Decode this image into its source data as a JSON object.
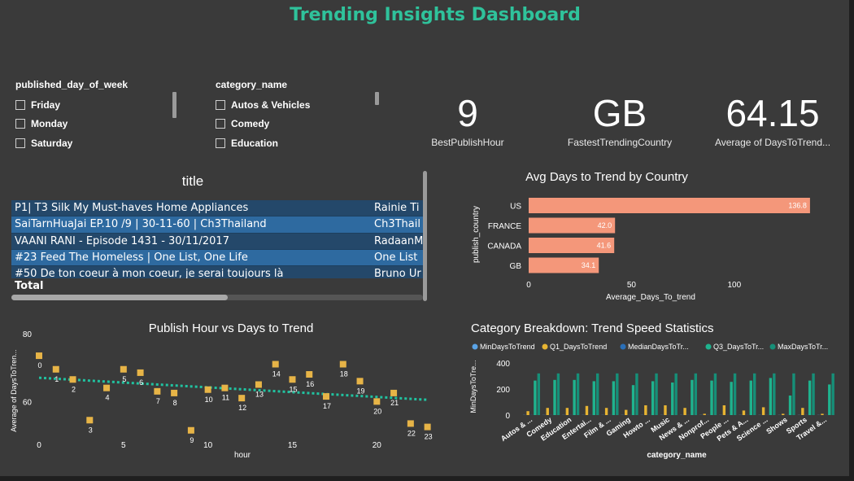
{
  "dashboard": {
    "title": "Trending Insights Dashboard"
  },
  "slicers": {
    "day": {
      "header": "published_day_of_week",
      "items": [
        "Friday",
        "Monday",
        "Saturday"
      ]
    },
    "category": {
      "header": "category_name",
      "items": [
        "Autos & Vehicles",
        "Comedy",
        "Education"
      ]
    }
  },
  "kpis": [
    {
      "value": "9",
      "label": "BestPublishHour"
    },
    {
      "value": "GB",
      "label": "FastestTrendingCountry"
    },
    {
      "value": "64.15",
      "label": "Average of DaysToTrend..."
    }
  ],
  "table": {
    "heading": "title",
    "rows": [
      {
        "title": "P1| T3 Silk My Must-haves Home Appliances",
        "channel": "Rainie Ti"
      },
      {
        "title": "SaiTarnHuaJai EP.10 /9 | 30-11-60 | Ch3Thailand",
        "channel": "Ch3Thail"
      },
      {
        "title": "VAANI RANI - Episode 1431 - 30/11/2017",
        "channel": "RadaanM"
      },
      {
        "title": "#23 Feed The Homeless | One List, One Life",
        "channel": "One List"
      },
      {
        "title": "#50 De ton coeur à mon coeur, je serai toujours là",
        "channel": "Bruno Ur"
      }
    ],
    "total_label": "Total"
  },
  "country_chart": {
    "chart_data": {
      "type": "bar",
      "orientation": "horizontal",
      "title": "Avg Days to Trend by Country",
      "xlabel": "Average_Days_To_trend",
      "ylabel": "publish_country",
      "categories": [
        "US",
        "FRANCE",
        "CANADA",
        "GB"
      ],
      "values": [
        136.8,
        42.0,
        41.6,
        34.1
      ],
      "data_labels": [
        "136.8",
        "42.0",
        "41.6",
        "34.1"
      ],
      "xlim": [
        0,
        140
      ],
      "xticks": [
        "0",
        "50",
        "100"
      ],
      "color": "#f4977a"
    }
  },
  "scatter_chart": {
    "chart_data": {
      "type": "scatter",
      "title": "Publish Hour vs Days to Trend",
      "xlabel": "hour",
      "ylabel": "Average of DaysToTren...",
      "x": [
        0,
        1,
        2,
        3,
        4,
        5,
        6,
        7,
        8,
        9,
        10,
        11,
        12,
        13,
        14,
        15,
        16,
        17,
        18,
        19,
        20,
        21,
        22,
        23
      ],
      "y": [
        73.5,
        69.5,
        66.5,
        54.5,
        64.0,
        69.5,
        68.5,
        63.0,
        62.5,
        51.5,
        63.5,
        64.0,
        61.0,
        65.0,
        71.0,
        66.5,
        68.0,
        61.5,
        71.0,
        66.0,
        60.0,
        62.5,
        53.5,
        52.5
      ],
      "point_labels": [
        "0",
        "1",
        "2",
        "3",
        "4",
        "5",
        "6",
        "7",
        "8",
        "9",
        "10",
        "11",
        "12",
        "13",
        "14",
        "15",
        "16",
        "17",
        "18",
        "19",
        "20",
        "21",
        "22",
        "23"
      ],
      "trendline": {
        "start": [
          0,
          67.0
        ],
        "end": [
          23,
          60.5
        ]
      },
      "xlim": [
        0,
        23.5
      ],
      "ylim": [
        50,
        80
      ],
      "xticks": [
        "0",
        "5",
        "10",
        "15",
        "20"
      ],
      "yticks": [
        "60",
        "80"
      ],
      "point_color": "#e7b447",
      "trend_color": "#21c2a0"
    }
  },
  "category_chart": {
    "chart_data": {
      "type": "bar",
      "title": "Category Breakdown: Trend Speed Statistics",
      "xlabel": "category_name",
      "ylabel": "MinDaysToTre...",
      "ylim": [
        0,
        450
      ],
      "yticks": [
        "0",
        "200",
        "400"
      ],
      "categories": [
        "Autos & ...",
        "Comedy",
        "Education",
        "Entertai...",
        "Film & ...",
        "Gaming",
        "Howto ...",
        "Music",
        "News & ...",
        "Nonprof...",
        "People ...",
        "Pets & A...",
        "Science ...",
        "Shows",
        "Sports",
        "Travel &..."
      ],
      "series": [
        {
          "name": "MinDaysToTrend",
          "color": "#5aa3e6",
          "values": [
            1,
            1,
            1,
            1,
            1,
            1,
            1,
            1,
            1,
            1,
            1,
            1,
            1,
            1,
            1,
            1
          ]
        },
        {
          "name": "Q1_DaysToTrend",
          "color": "#e7b432",
          "values": [
            30,
            55,
            55,
            70,
            55,
            40,
            75,
            75,
            55,
            10,
            75,
            35,
            60,
            10,
            55,
            10
          ]
        },
        {
          "name": "MedianDaysToTr...",
          "color": "#2a6fb8",
          "values": [
            1,
            1,
            1,
            1,
            1,
            1,
            1,
            1,
            1,
            1,
            1,
            1,
            1,
            1,
            1,
            1
          ]
        },
        {
          "name": "Q3_DaysToTr...",
          "color": "#1fb38e",
          "values": [
            265,
            270,
            270,
            260,
            260,
            230,
            260,
            250,
            270,
            265,
            255,
            265,
            285,
            150,
            265,
            235
          ]
        },
        {
          "name": "MaxDaysToTr...",
          "color": "#168f78",
          "values": [
            320,
            320,
            320,
            320,
            320,
            320,
            320,
            320,
            320,
            320,
            320,
            320,
            320,
            320,
            320,
            320
          ]
        }
      ]
    }
  }
}
